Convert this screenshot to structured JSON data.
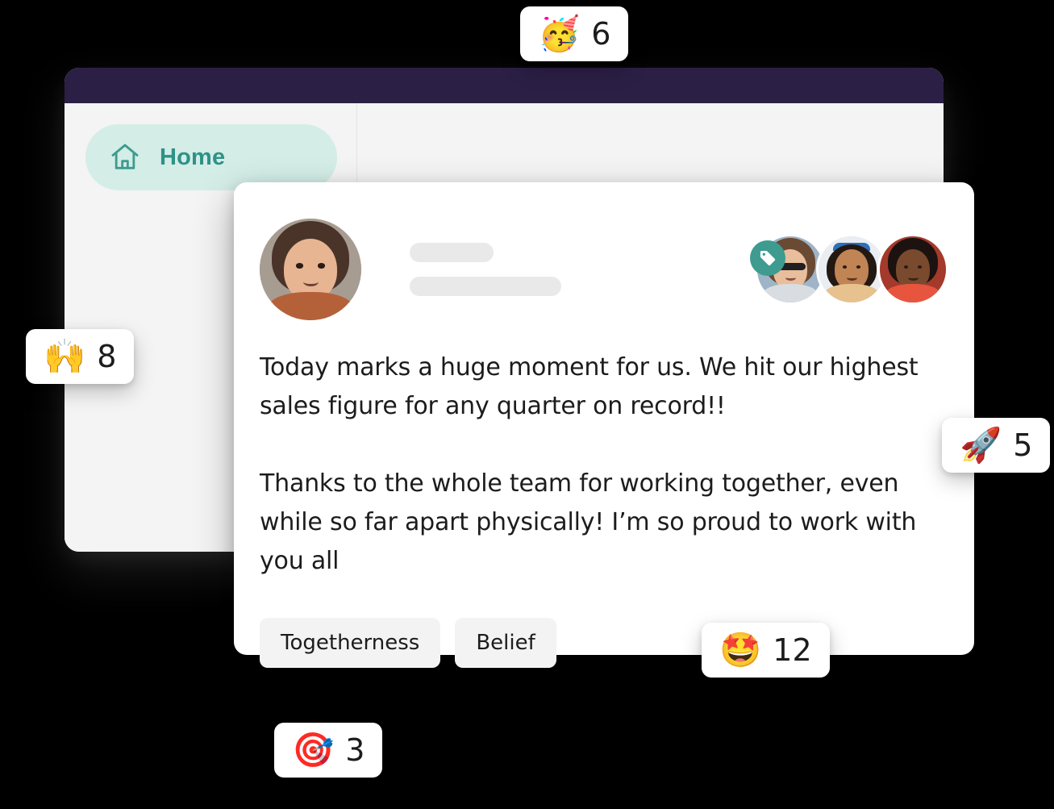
{
  "app": {
    "window_title": "",
    "sidebar": {
      "items": [
        {
          "id": "home",
          "label": "Home",
          "icon": "home-icon",
          "active": true
        }
      ]
    },
    "theme": {
      "titlebar_color": "#2B1F45",
      "sidebar_bg": "#F4F4F4",
      "accent_teal": "#3E9B8F",
      "active_pill_bg": "#D4EDE7",
      "nav_label_color": "#2E9287",
      "card_bg": "#FFFFFF",
      "page_bg": "#000000",
      "tag_bg": "#F3F3F3",
      "skeleton_bg": "#E9E9E9"
    }
  },
  "post": {
    "author": {
      "avatar_alt": "author-avatar",
      "name_placeholder_visible": true,
      "meta_placeholder_visible": true
    },
    "tag_badge_icon": "tag-icon",
    "recipients": [
      {
        "id": "recipient-1",
        "alt": "recipient-avatar-1"
      },
      {
        "id": "recipient-2",
        "alt": "recipient-avatar-2"
      },
      {
        "id": "recipient-3",
        "alt": "recipient-avatar-3"
      }
    ],
    "paragraphs": [
      "Today marks a huge moment for us. We hit our highest sales figure for any quarter on record!!",
      "Thanks to the whole team for working together, even while so far apart physically! I’m so proud to work with you all"
    ],
    "value_tags": [
      {
        "id": "togetherness",
        "label": "Togetherness"
      },
      {
        "id": "belief",
        "label": "Belief"
      }
    ]
  },
  "reactions": [
    {
      "id": "party",
      "emoji": "🥳",
      "icon": "partying-face-emoji",
      "count": "6"
    },
    {
      "id": "hands",
      "emoji": "🙌",
      "icon": "raising-hands-emoji",
      "count": "8"
    },
    {
      "id": "rocket",
      "emoji": "🚀",
      "icon": "rocket-emoji",
      "count": "5"
    },
    {
      "id": "star",
      "emoji": "🤩",
      "icon": "star-struck-emoji",
      "count": "12"
    },
    {
      "id": "dart",
      "emoji": "🎯",
      "icon": "direct-hit-emoji",
      "count": "3"
    }
  ]
}
